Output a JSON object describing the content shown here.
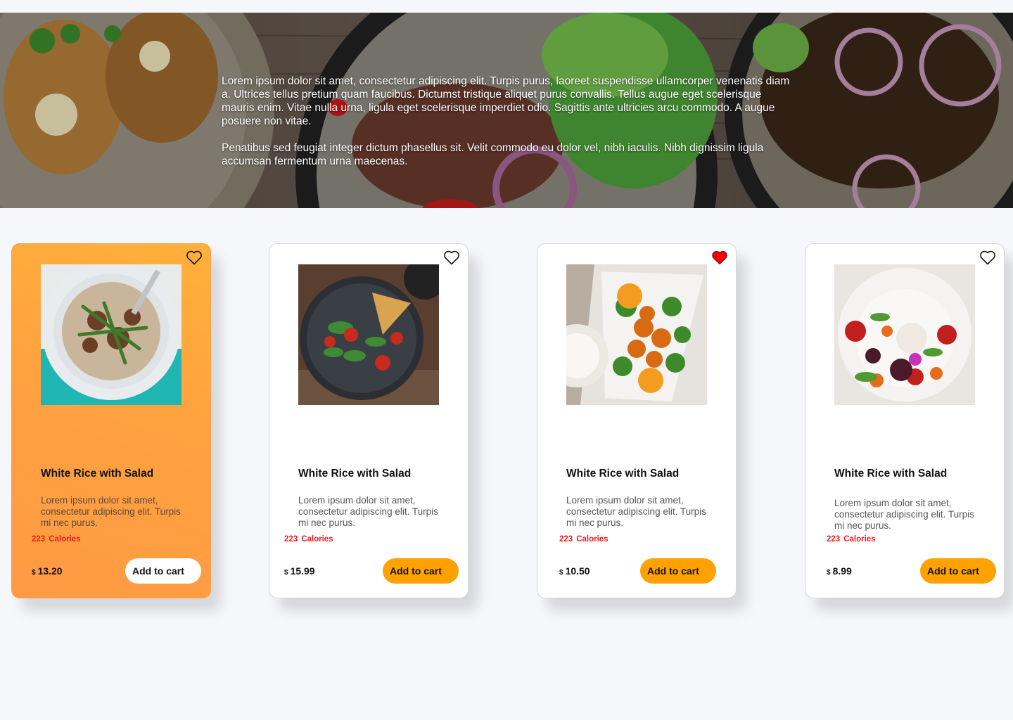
{
  "hero": {
    "paragraph1": "Lorem ipsum dolor sit amet, consectetur adipiscing elit. Turpis purus, laoreet suspendisse ullamcorper venenatis diam a. Ultrices tellus pretium quam faucibus. Dictumst tristique aliquet purus convallis. Tellus augue eget scelerisque mauris enim. Vitae nulla urna, ligula eget scelerisque imperdiet odio. Sagittis ante ultricies arcu commodo. A augue posuere non vitae.",
    "paragraph2": "Penatibus sed feugiat integer dictum phasellus sit. Velit commodo eu dolor vel, nibh iaculis. Nibh dignissim ligula accumsan fermentum urna maecenas."
  },
  "colors": {
    "accent": "#ffa100",
    "active_card_gradient_start": "#ffb03a",
    "active_card_gradient_end": "#ff9a44",
    "calories": "#ee1b1b",
    "favorite": "#ff0000",
    "page_background": "#f6f7fb"
  },
  "cards": [
    {
      "title": "White Rice with Salad",
      "description": "Lorem ipsum dolor sit amet, consectetur adipiscing elit. Turpis mi nec purus.",
      "calories_value": "223",
      "calories_label": "Calories",
      "currency": "$",
      "price": "13.20",
      "button_label": "Add to cart",
      "favorite": false,
      "active": true,
      "icon": "heart-outline-icon"
    },
    {
      "title": "White Rice with Salad",
      "description": "Lorem ipsum dolor sit amet, consectetur adipiscing elit. Turpis mi nec purus.",
      "calories_value": "223",
      "calories_label": "Calories",
      "currency": "$",
      "price": "15.99",
      "button_label": "Add to cart",
      "favorite": false,
      "active": false,
      "icon": "heart-outline-icon"
    },
    {
      "title": "White Rice with Salad",
      "description": "Lorem ipsum dolor sit amet, consectetur adipiscing elit. Turpis mi nec purus.",
      "calories_value": "223",
      "calories_label": "Calories",
      "currency": "$",
      "price": "10.50",
      "button_label": "Add to cart",
      "favorite": true,
      "active": false,
      "icon": "heart-filled-icon"
    },
    {
      "title": "White Rice with Salad",
      "description": "Lorem ipsum dolor sit amet, consectetur adipiscing elit. Turpis mi nec purus.",
      "calories_value": "223",
      "calories_label": "Calories",
      "currency": "$",
      "price": "8.99",
      "button_label": "Add to cart",
      "favorite": false,
      "active": false,
      "icon": "heart-outline-icon"
    }
  ]
}
